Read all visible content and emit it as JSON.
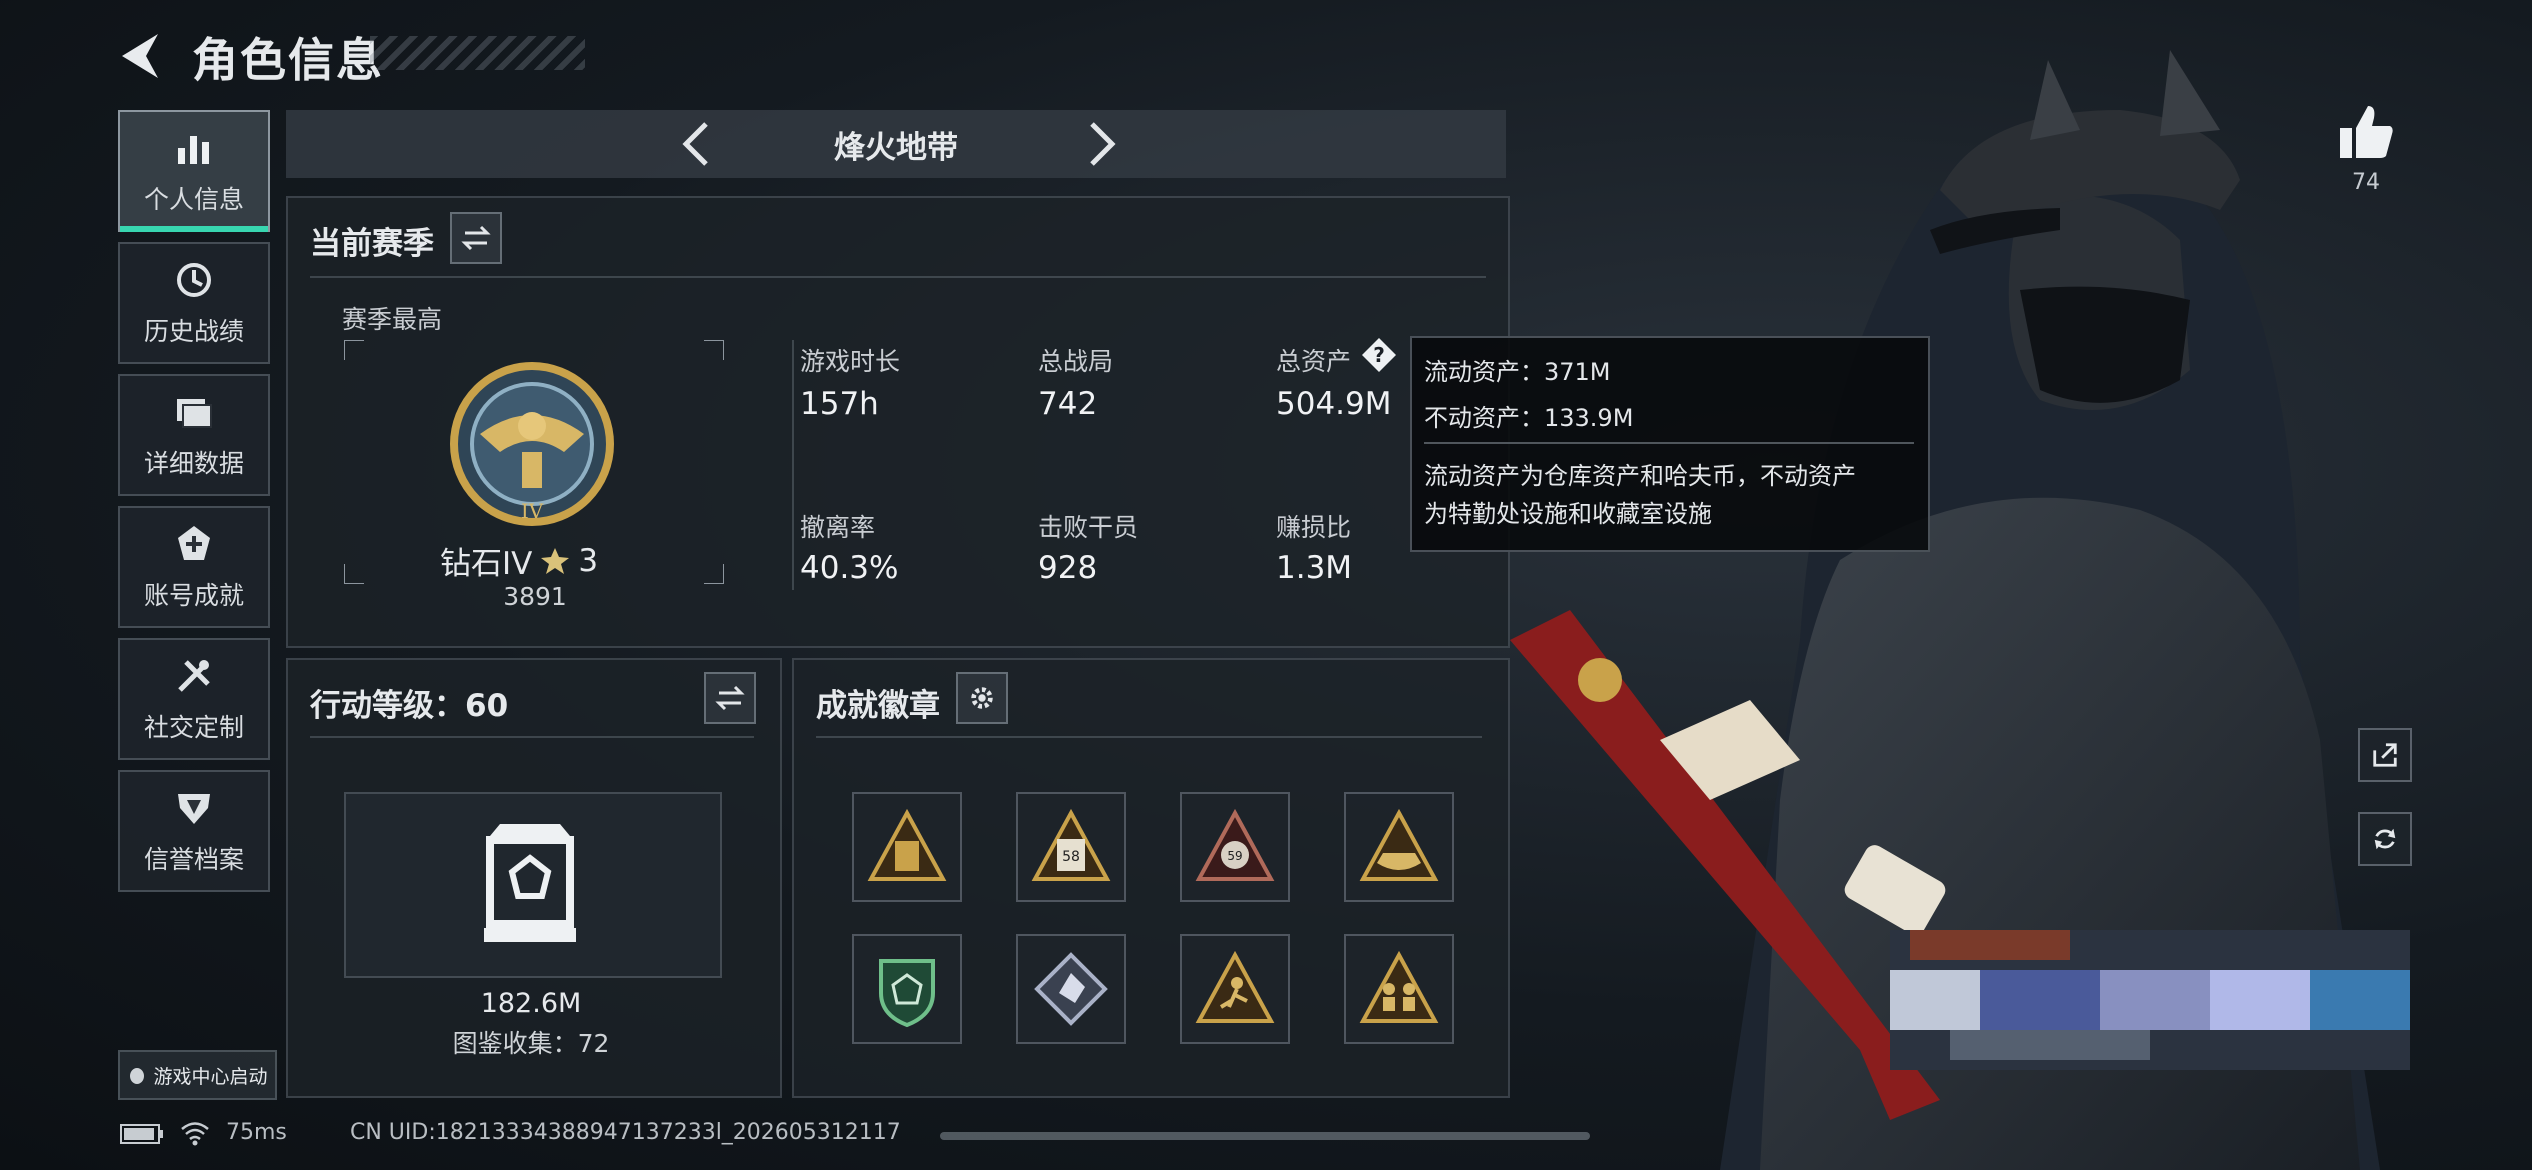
{
  "header": {
    "title": "角色信息"
  },
  "sidebar": {
    "items": [
      {
        "label": "个人信息",
        "icon": "bar-chart-icon",
        "active": true
      },
      {
        "label": "历史战绩",
        "icon": "clock-history-icon",
        "active": false
      },
      {
        "label": "详细数据",
        "icon": "folder-icon",
        "active": false
      },
      {
        "label": "账号成就",
        "icon": "trophy-plus-icon",
        "active": false
      },
      {
        "label": "社交定制",
        "icon": "tools-icon",
        "active": false
      },
      {
        "label": "信誉档案",
        "icon": "shield-badge-icon",
        "active": false
      }
    ],
    "game_center_label": "游戏中心启动"
  },
  "mode": {
    "name": "烽火地带"
  },
  "season": {
    "title": "当前赛季",
    "best_label": "赛季最高",
    "rank_name": "钻石IV",
    "rank_stars": "3",
    "rank_points": "3891",
    "rank_emblem_numeral": "IV",
    "stats": [
      {
        "label": "游戏时长",
        "value": "157h"
      },
      {
        "label": "总战局",
        "value": "742"
      },
      {
        "label": "总资产",
        "value": "504.9M"
      },
      {
        "label": "撤离率",
        "value": "40.3%"
      },
      {
        "label": "击败干员",
        "value": "928"
      },
      {
        "label": "赚损比",
        "value": "1.3M"
      }
    ]
  },
  "tooltip": {
    "liquid": "流动资产：371M",
    "fixed": "不动资产：133.9M",
    "note_line1": "流动资产为仓库资产和哈夫币，不动资产",
    "note_line2": "为特勤处设施和收藏室设施"
  },
  "action": {
    "title": "行动等级：60",
    "collection_value": "182.6M",
    "collection_label": "图鉴收集：72"
  },
  "badges": {
    "title": "成就徽章",
    "items": [
      {
        "icon": "hourglass-badge-icon"
      },
      {
        "icon": "number-58-badge-icon",
        "number": "58"
      },
      {
        "icon": "number-59-badge-icon",
        "number": "59"
      },
      {
        "icon": "boat-badge-icon"
      },
      {
        "icon": "green-shield-badge-icon"
      },
      {
        "icon": "crystal-badge-icon"
      },
      {
        "icon": "runner-badge-icon"
      },
      {
        "icon": "figures-badge-icon"
      }
    ]
  },
  "right": {
    "like_count": "74"
  },
  "status": {
    "ping": "75ms",
    "uid": "CN UID:18213334388947137233l_202605312117"
  },
  "colors": {
    "accent": "#38d6b0",
    "gold": "#c9a24a",
    "panel_border": "#5a636c"
  }
}
